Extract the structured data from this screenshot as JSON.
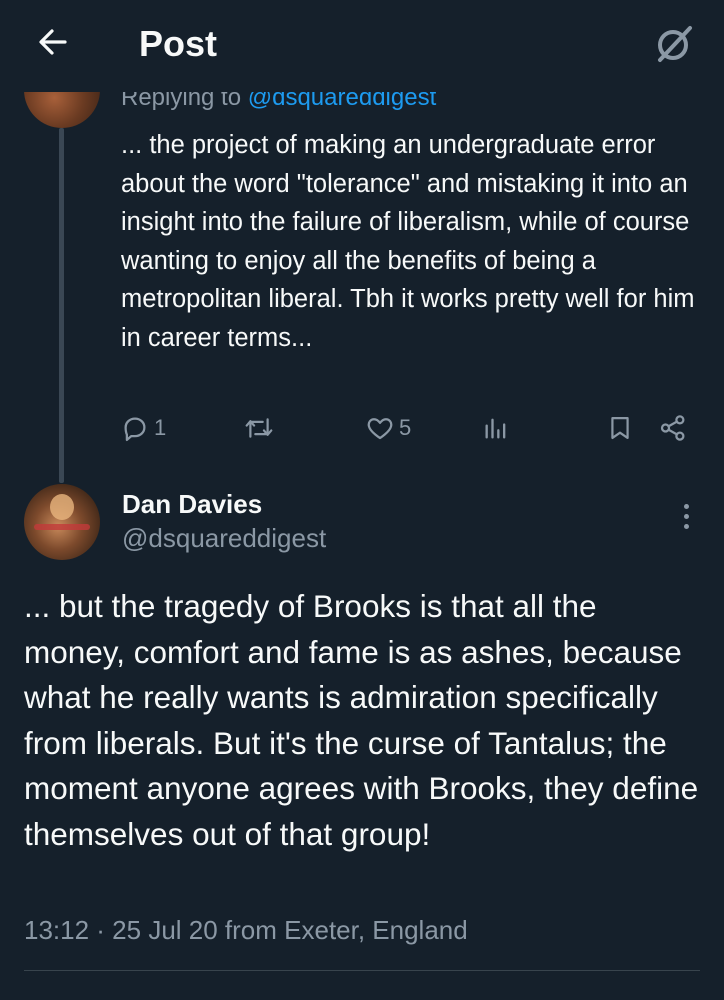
{
  "header": {
    "title": "Post",
    "back_icon": "arrow-left-icon",
    "grok_icon": "grok-icon"
  },
  "parent_tweet": {
    "replying_prefix": "Replying to ",
    "replying_handle": "@dsquareddigest",
    "text": "... the project of making an undergraduate error about the word \"tolerance\" and mistaking it into an insight into the failure of liberalism, while of course wanting to enjoy all the benefits of being a metropolitan liberal. Tbh it works pretty well for him in career terms...",
    "actions": {
      "replies": "1",
      "retweets": "",
      "likes": "5",
      "views": ""
    }
  },
  "main_tweet": {
    "author_name": "Dan Davies",
    "author_handle": "@dsquareddigest",
    "text": "... but the tragedy of Brooks is that all the money, comfort and fame is as ashes, because what he really wants is admiration specifically from liberals. But it's the curse of Tantalus; the moment anyone agrees with Brooks, they define themselves out of that group!",
    "meta": "13:12 · 25 Jul 20 from Exeter, England"
  },
  "colors": {
    "background": "#15202b",
    "text": "#f7f9f9",
    "muted": "#8b98a5",
    "accent": "#1d9bf0",
    "thread_line": "#3a4754"
  }
}
